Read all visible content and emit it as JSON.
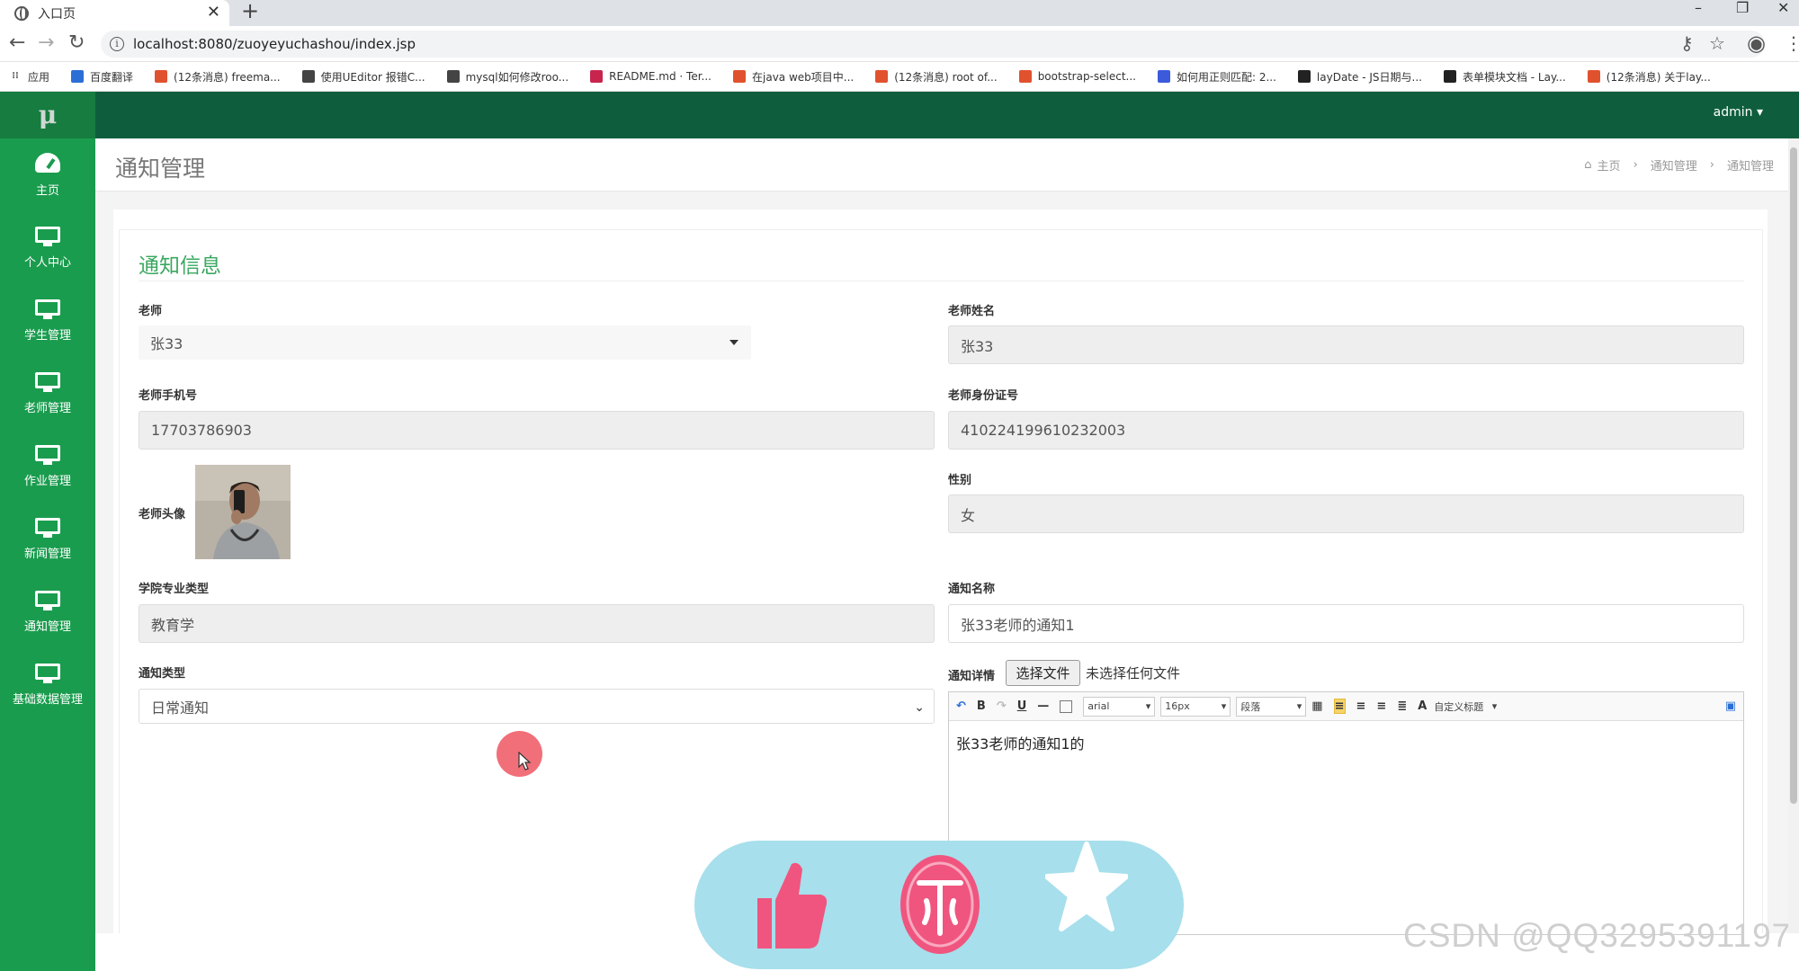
{
  "browser": {
    "tab_title": "入口页",
    "url": "localhost:8080/zuoyeyuchashou/index.jsp",
    "bookmarks": [
      {
        "label": "应用",
        "color": "#5f6368"
      },
      {
        "label": "百度翻译",
        "color": "#2b6fd6"
      },
      {
        "label": "(12条消息) freema...",
        "color": "#e0522d"
      },
      {
        "label": "使用UEditor 报错C...",
        "color": "#444444"
      },
      {
        "label": "mysql如何修改roo...",
        "color": "#444444"
      },
      {
        "label": "README.md · Ter...",
        "color": "#c7254e"
      },
      {
        "label": "在java web项目中...",
        "color": "#e0522d"
      },
      {
        "label": "(12条消息) root of...",
        "color": "#e0522d"
      },
      {
        "label": "bootstrap-select...",
        "color": "#e0522d"
      },
      {
        "label": "如何用正则匹配: 2...",
        "color": "#3b5bdb"
      },
      {
        "label": "layDate - JS日期与...",
        "color": "#222222"
      },
      {
        "label": "表单模块文档 - Lay...",
        "color": "#222222"
      },
      {
        "label": "(12条消息) 关于lay...",
        "color": "#e0522d"
      }
    ]
  },
  "app": {
    "logo": "μ",
    "user": "admin ▾",
    "sidebar": [
      {
        "label": "主页",
        "icon": "dashboard-icon"
      },
      {
        "label": "个人中心",
        "icon": "monitor-icon"
      },
      {
        "label": "学生管理",
        "icon": "monitor-icon"
      },
      {
        "label": "老师管理",
        "icon": "monitor-icon"
      },
      {
        "label": "作业管理",
        "icon": "monitor-icon"
      },
      {
        "label": "新闻管理",
        "icon": "monitor-icon"
      },
      {
        "label": "通知管理",
        "icon": "monitor-icon"
      },
      {
        "label": "基础数据管理",
        "icon": "monitor-icon"
      }
    ],
    "page_title": "通知管理",
    "breadcrumb": [
      "主页",
      "通知管理",
      "通知管理"
    ],
    "form": {
      "section_title": "通知信息",
      "teacher_label": "老师",
      "teacher_value": "张33",
      "teacher_name_label": "老师姓名",
      "teacher_name_value": "张33",
      "phone_label": "老师手机号",
      "phone_value": "17703786903",
      "idcard_label": "老师身份证号",
      "idcard_value": "410224199610232003",
      "avatar_label": "老师头像",
      "gender_label": "性别",
      "gender_value": "女",
      "major_label": "学院专业类型",
      "major_value": "教育学",
      "notice_name_label": "通知名称",
      "notice_name_value": "张33老师的通知1",
      "notice_type_label": "通知类型",
      "notice_type_value": "日常通知",
      "detail_label": "通知详情",
      "file_button": "选择文件",
      "file_status": "未选择任何文件",
      "editor_font": "arial",
      "editor_size": "16px",
      "editor_paragraph": "段落",
      "editor_title": "自定义标题",
      "editor_content": "张33老师的通知1的"
    }
  },
  "watermark": "CSDN @QQ3295391197",
  "colors": {
    "sidebar": "#1a9c4e",
    "topbar": "#0e5e3e",
    "accent": "#3aa860",
    "like_bar": "#a7dfec",
    "like_pink": "#f0557f"
  }
}
